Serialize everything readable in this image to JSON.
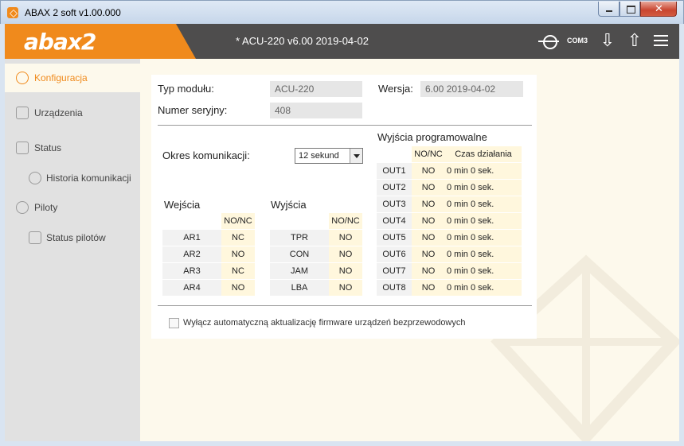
{
  "window": {
    "title": "ABAX 2 soft v1.00.000"
  },
  "header": {
    "logo": "abax2",
    "module_title": "*   ACU-220 v6.00 2019-04-02",
    "com_label": "COM3"
  },
  "sidebar": {
    "items": [
      {
        "label": "Konfiguracja",
        "icon": "config-icon",
        "active": true
      },
      {
        "label": "Urządzenia",
        "icon": "device-icon"
      },
      {
        "label": "Status",
        "icon": "status-icon"
      },
      {
        "label": "Historia komunikacji",
        "icon": "history-icon"
      },
      {
        "label": "Piloty",
        "icon": "remote-icon"
      },
      {
        "label": "Status pilotów",
        "icon": "remote-status-icon"
      }
    ]
  },
  "module": {
    "type_label": "Typ modułu:",
    "type_value": "ACU-220",
    "version_label": "Wersja:",
    "version_value": "6.00 2019-04-02",
    "serial_label": "Numer seryjny:",
    "serial_value": "408"
  },
  "comm": {
    "period_label": "Okres komunikacji:",
    "period_value": "12 sekund"
  },
  "inputs": {
    "title": "Wejścia",
    "col": "NO/NC",
    "rows": [
      {
        "name": "AR1",
        "value": "NC"
      },
      {
        "name": "AR2",
        "value": "NO"
      },
      {
        "name": "AR3",
        "value": "NC"
      },
      {
        "name": "AR4",
        "value": "NO"
      }
    ]
  },
  "outputs": {
    "title": "Wyjścia",
    "col": "NO/NC",
    "rows": [
      {
        "name": "TPR",
        "value": "NO"
      },
      {
        "name": "CON",
        "value": "NO"
      },
      {
        "name": "JAM",
        "value": "NO"
      },
      {
        "name": "LBA",
        "value": "NO"
      }
    ]
  },
  "prog_outputs": {
    "title": "Wyjścia programowalne",
    "col1": "NO/NC",
    "col2": "Czas działania",
    "rows": [
      {
        "name": "OUT1",
        "value": "NO",
        "time": "0 min 0 sek."
      },
      {
        "name": "OUT2",
        "value": "NO",
        "time": "0 min 0 sek."
      },
      {
        "name": "OUT3",
        "value": "NO",
        "time": "0 min 0 sek."
      },
      {
        "name": "OUT4",
        "value": "NO",
        "time": "0 min 0 sek."
      },
      {
        "name": "OUT5",
        "value": "NO",
        "time": "0 min 0 sek."
      },
      {
        "name": "OUT6",
        "value": "NO",
        "time": "0 min 0 sek."
      },
      {
        "name": "OUT7",
        "value": "NO",
        "time": "0 min 0 sek."
      },
      {
        "name": "OUT8",
        "value": "NO",
        "time": "0 min 0 sek."
      }
    ]
  },
  "firmware": {
    "checkbox_label": "Wyłącz automatyczną aktualizację firmware urządzeń bezprzewodowych",
    "checked": false
  },
  "colors": {
    "accent": "#f08a1c",
    "header": "#4e4d4d",
    "sidebar": "#e1e1e1"
  }
}
